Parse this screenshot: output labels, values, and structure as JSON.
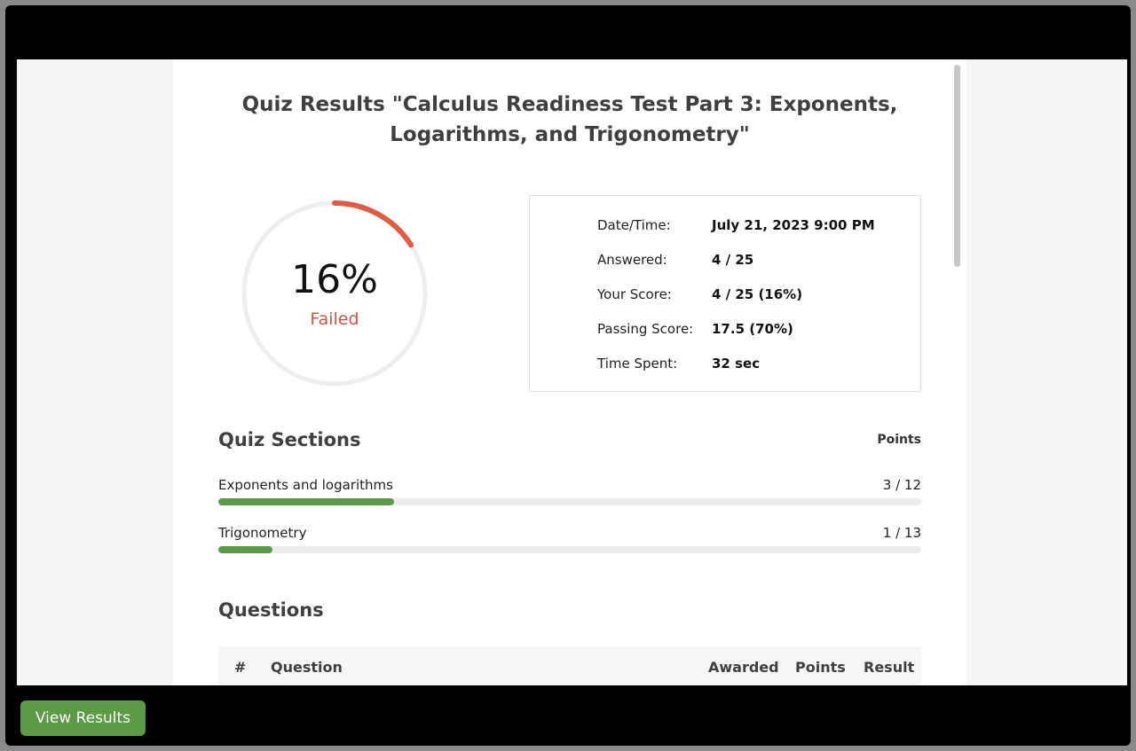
{
  "quiz": {
    "title": "Quiz Results \"Calculus Readiness Test Part 3: Exponents, Logarithms, and Trigonometry\""
  },
  "gauge": {
    "percent_text": "16%",
    "percent_value": 0.16,
    "status": "Failed",
    "colors": {
      "arc": "#e05c44",
      "track": "#eeeeee",
      "status": "#c25a48"
    }
  },
  "stats": [
    {
      "label": "Date/Time:",
      "value": "July 21, 2023 9:00 PM"
    },
    {
      "label": "Answered:",
      "value": "4 / 25"
    },
    {
      "label": "Your Score:",
      "value": "4 / 25 (16%)"
    },
    {
      "label": "Passing Score:",
      "value": "17.5 (70%)"
    },
    {
      "label": "Time Spent:",
      "value": "32 sec"
    }
  ],
  "sections": {
    "heading": "Quiz Sections",
    "points_heading": "Points",
    "items": [
      {
        "name": "Exponents and logarithms",
        "points": "3 / 12",
        "fraction": 0.25
      },
      {
        "name": "Trigonometry",
        "points": "1 / 13",
        "fraction": 0.077
      }
    ]
  },
  "questions": {
    "heading": "Questions",
    "columns": {
      "num": "#",
      "question": "Question",
      "awarded": "Awarded",
      "points": "Points",
      "result": "Result"
    }
  },
  "footer": {
    "view_results_label": "View Results"
  },
  "colors": {
    "accent_green": "#5c9a46",
    "progress_green": "#5b9a47"
  }
}
